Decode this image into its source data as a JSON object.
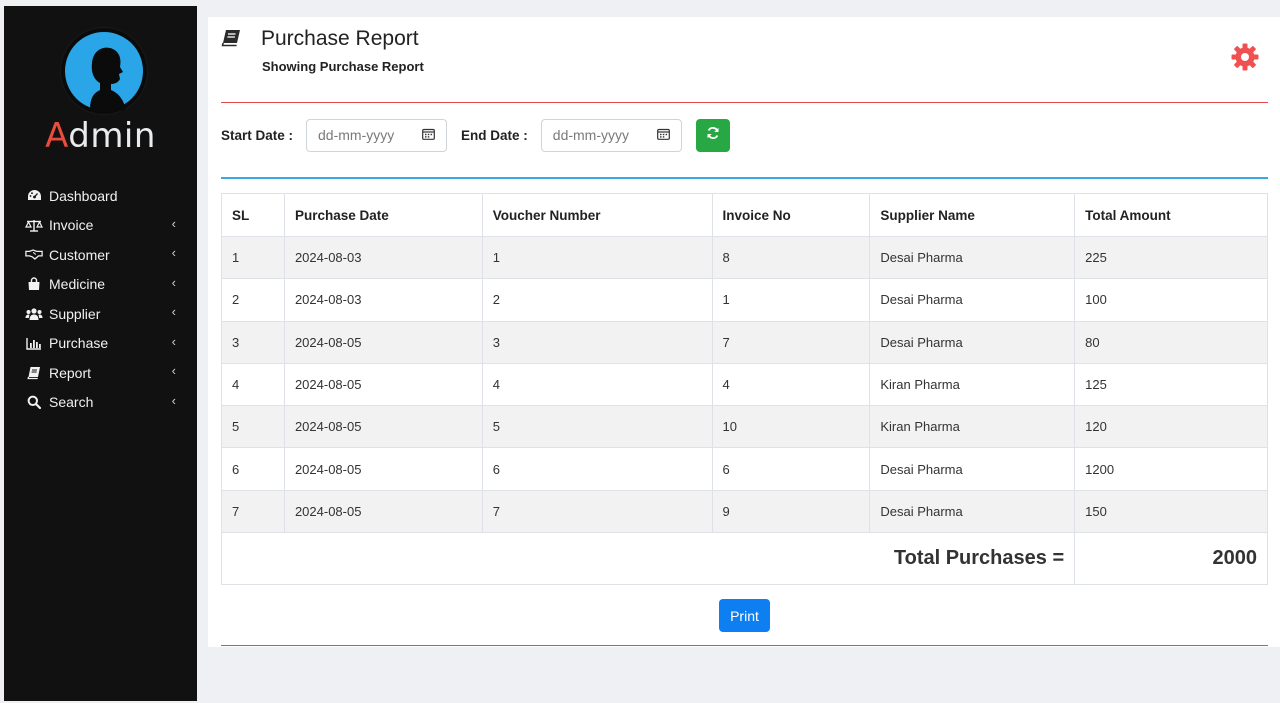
{
  "sidebar": {
    "brand_first": "A",
    "brand_rest": "dmin",
    "items": [
      {
        "label": "Dashboard",
        "icon": "dashboard-icon"
      },
      {
        "label": "Invoice",
        "icon": "balance-scale-icon"
      },
      {
        "label": "Customer",
        "icon": "handshake-icon"
      },
      {
        "label": "Medicine",
        "icon": "shopping-bag-icon"
      },
      {
        "label": "Supplier",
        "icon": "users-icon"
      },
      {
        "label": "Purchase",
        "icon": "bar-chart-icon"
      },
      {
        "label": "Report",
        "icon": "book-icon"
      },
      {
        "label": "Search",
        "icon": "search-icon"
      }
    ]
  },
  "header": {
    "title": "Purchase Report",
    "subtitle": "Showing Purchase Report"
  },
  "filters": {
    "start_label": "Start Date :",
    "end_label": "End Date :",
    "start_placeholder": "dd-mm-yyyy",
    "end_placeholder": "dd-mm-yyyy"
  },
  "table": {
    "columns": [
      "SL",
      "Purchase Date",
      "Voucher Number",
      "Invoice No",
      "Supplier Name",
      "Total Amount"
    ],
    "rows": [
      [
        "1",
        "2024-08-03",
        "1",
        "8",
        "Desai Pharma",
        "225"
      ],
      [
        "2",
        "2024-08-03",
        "2",
        "1",
        "Desai Pharma",
        "100"
      ],
      [
        "3",
        "2024-08-05",
        "3",
        "7",
        "Desai Pharma",
        "80"
      ],
      [
        "4",
        "2024-08-05",
        "4",
        "4",
        "Kiran Pharma",
        "125"
      ],
      [
        "5",
        "2024-08-05",
        "5",
        "10",
        "Kiran Pharma",
        "120"
      ],
      [
        "6",
        "2024-08-05",
        "6",
        "6",
        "Desai Pharma",
        "1200"
      ],
      [
        "7",
        "2024-08-05",
        "7",
        "9",
        "Desai Pharma",
        "150"
      ]
    ],
    "total_label": "Total Purchases =",
    "total_value": "2000"
  },
  "actions": {
    "print_label": "Print"
  },
  "colors": {
    "sidebar_bg": "#111111",
    "accent_red": "#e34b4b",
    "accent_blue": "#3aa8e3",
    "refresh_green": "#28a745",
    "print_blue": "#0d7ff0",
    "total_green": "#1a7f1a",
    "total_red": "#e31e1e"
  }
}
